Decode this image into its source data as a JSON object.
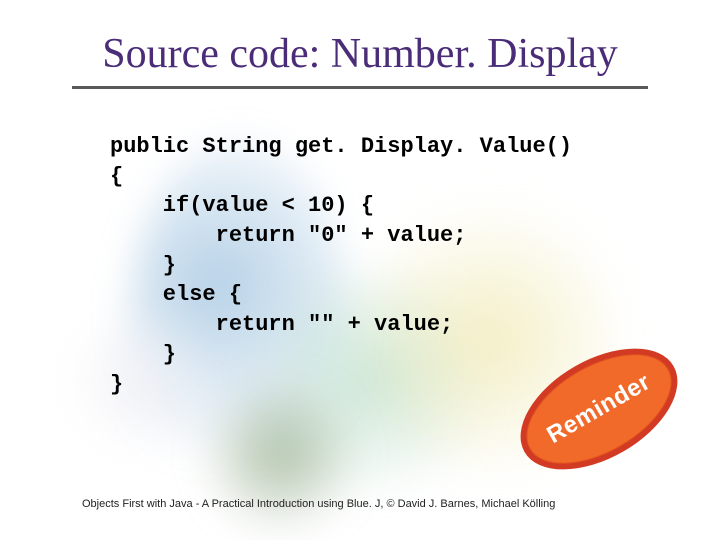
{
  "title": "Source code: Number. Display",
  "code_lines": [
    "public String get. Display. Value()",
    "{",
    "    if(value < 10) {",
    "        return \"0\" + value;",
    "    }",
    "    else {",
    "        return \"\" + value;",
    "    }",
    "}"
  ],
  "sticker_label": "Reminder",
  "footer": "Objects First with Java - A Practical Introduction using Blue. J, © David J. Barnes, Michael Kölling"
}
